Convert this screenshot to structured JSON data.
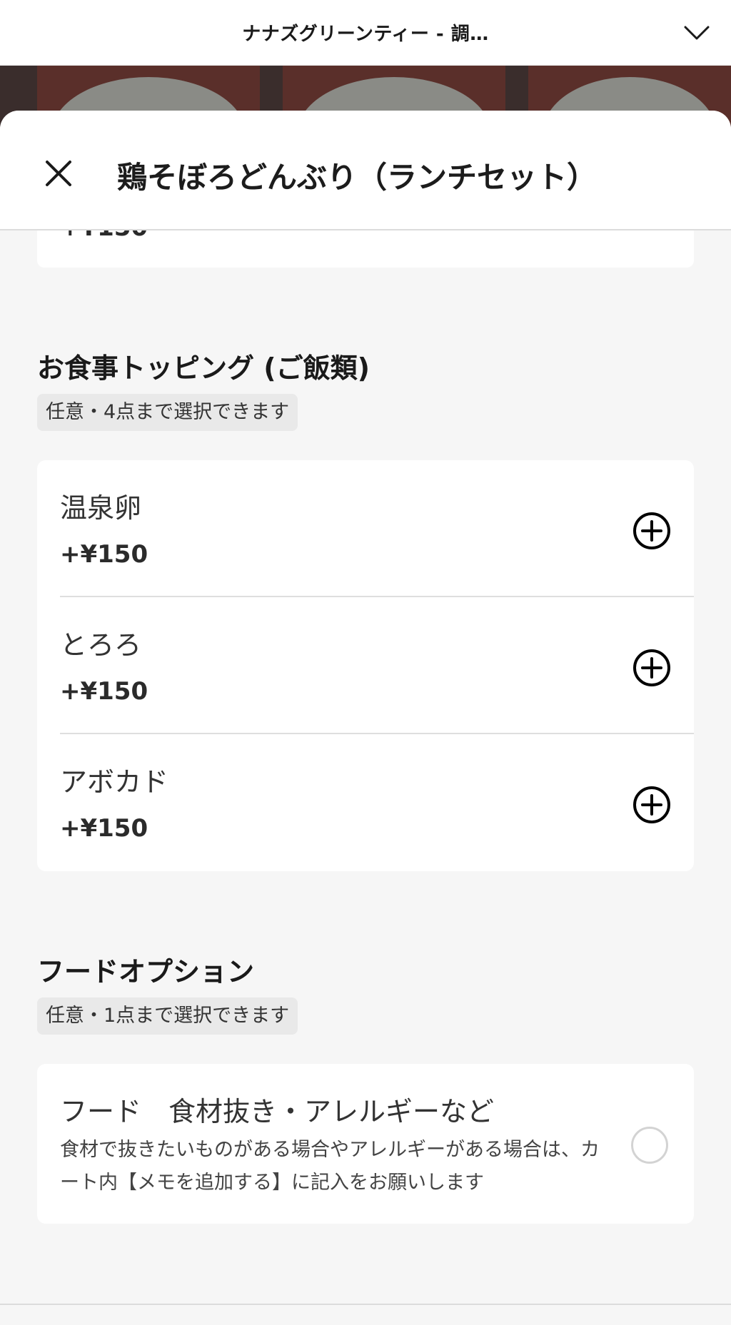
{
  "browser": {
    "title": "ナナズグリーンティー - 調…",
    "chevron_icon": "chevron-down-icon"
  },
  "sheet": {
    "title": "鶏そぼろどんぶり（ランチセット）",
    "close_icon": "close-icon",
    "prev_price_partial": "+¥150"
  },
  "toppings": {
    "title": "お食事トッピング (ご飯類)",
    "hint": "任意・4点まで選択できます",
    "items": [
      {
        "name": "温泉卵",
        "price": "+¥150"
      },
      {
        "name": "とろろ",
        "price": "+¥150"
      },
      {
        "name": "アボカド",
        "price": "+¥150"
      }
    ]
  },
  "food_option": {
    "title": "フードオプション",
    "hint": "任意・1点まで選択できます",
    "item": {
      "name": "フード　食材抜き・アレルギーなど",
      "description": "食材で抜きたいものがある場合やアレルギーがある場合は、カート内【メモを追加する】に記入をお願いします"
    }
  },
  "colors": {
    "accent": "#000000",
    "background": "#f6f6f6",
    "card": "#ffffff",
    "pill": "#e9e9e9"
  }
}
